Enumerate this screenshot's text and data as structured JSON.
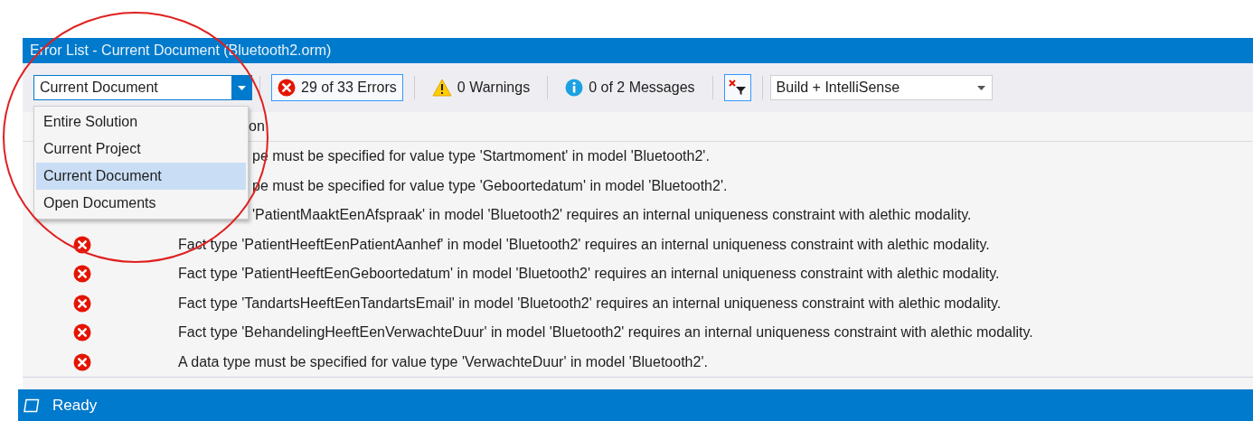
{
  "window": {
    "title": "Error List - Current Document (Bluetooth2.orm)"
  },
  "toolbar": {
    "scope": {
      "value": "Current Document",
      "expanded": true,
      "options": [
        {
          "label": "Entire Solution",
          "selected": false
        },
        {
          "label": "Current Project",
          "selected": false
        },
        {
          "label": "Current Document",
          "selected": true
        },
        {
          "label": "Open Documents",
          "selected": false
        }
      ]
    },
    "filters": [
      {
        "kind": "error",
        "label": "29 of 33 Errors",
        "selected": true
      },
      {
        "kind": "warning",
        "label": "0 Warnings",
        "selected": false
      },
      {
        "kind": "info",
        "label": "0 of 2 Messages",
        "selected": false
      }
    ],
    "filter_toggle": {
      "on": true
    },
    "source": {
      "value": "Build + IntelliSense"
    }
  },
  "table": {
    "header": "on",
    "rows": [
      {
        "kind": "covered",
        "text": "pe must be specified for value type 'Startmoment' in model 'Bluetooth2'."
      },
      {
        "kind": "covered",
        "text": "pe must be specified for value type 'Geboortedatum' in model 'Bluetooth2'."
      },
      {
        "kind": "covered",
        "text": "'PatientMaaktEenAfspraak' in model 'Bluetooth2' requires an internal uniqueness constraint with alethic modality."
      },
      {
        "kind": "error",
        "text": "Fact type 'PatientHeeftEenPatientAanhef' in model 'Bluetooth2' requires an internal uniqueness constraint with alethic modality."
      },
      {
        "kind": "error",
        "text": "Fact type 'PatientHeeftEenGeboortedatum' in model 'Bluetooth2' requires an internal uniqueness constraint with alethic modality."
      },
      {
        "kind": "error",
        "text": "Fact type 'TandartsHeeftEenTandartsEmail' in model 'Bluetooth2' requires an internal uniqueness constraint with alethic modality."
      },
      {
        "kind": "error",
        "text": "Fact type 'BehandelingHeeftEenVerwachteDuur' in model 'Bluetooth2' requires an internal uniqueness constraint with alethic modality."
      },
      {
        "kind": "error",
        "text": "A data type must be specified for value type 'VerwachteDuur' in model 'Bluetooth2'."
      }
    ]
  },
  "status_bar": {
    "text": "Ready"
  }
}
